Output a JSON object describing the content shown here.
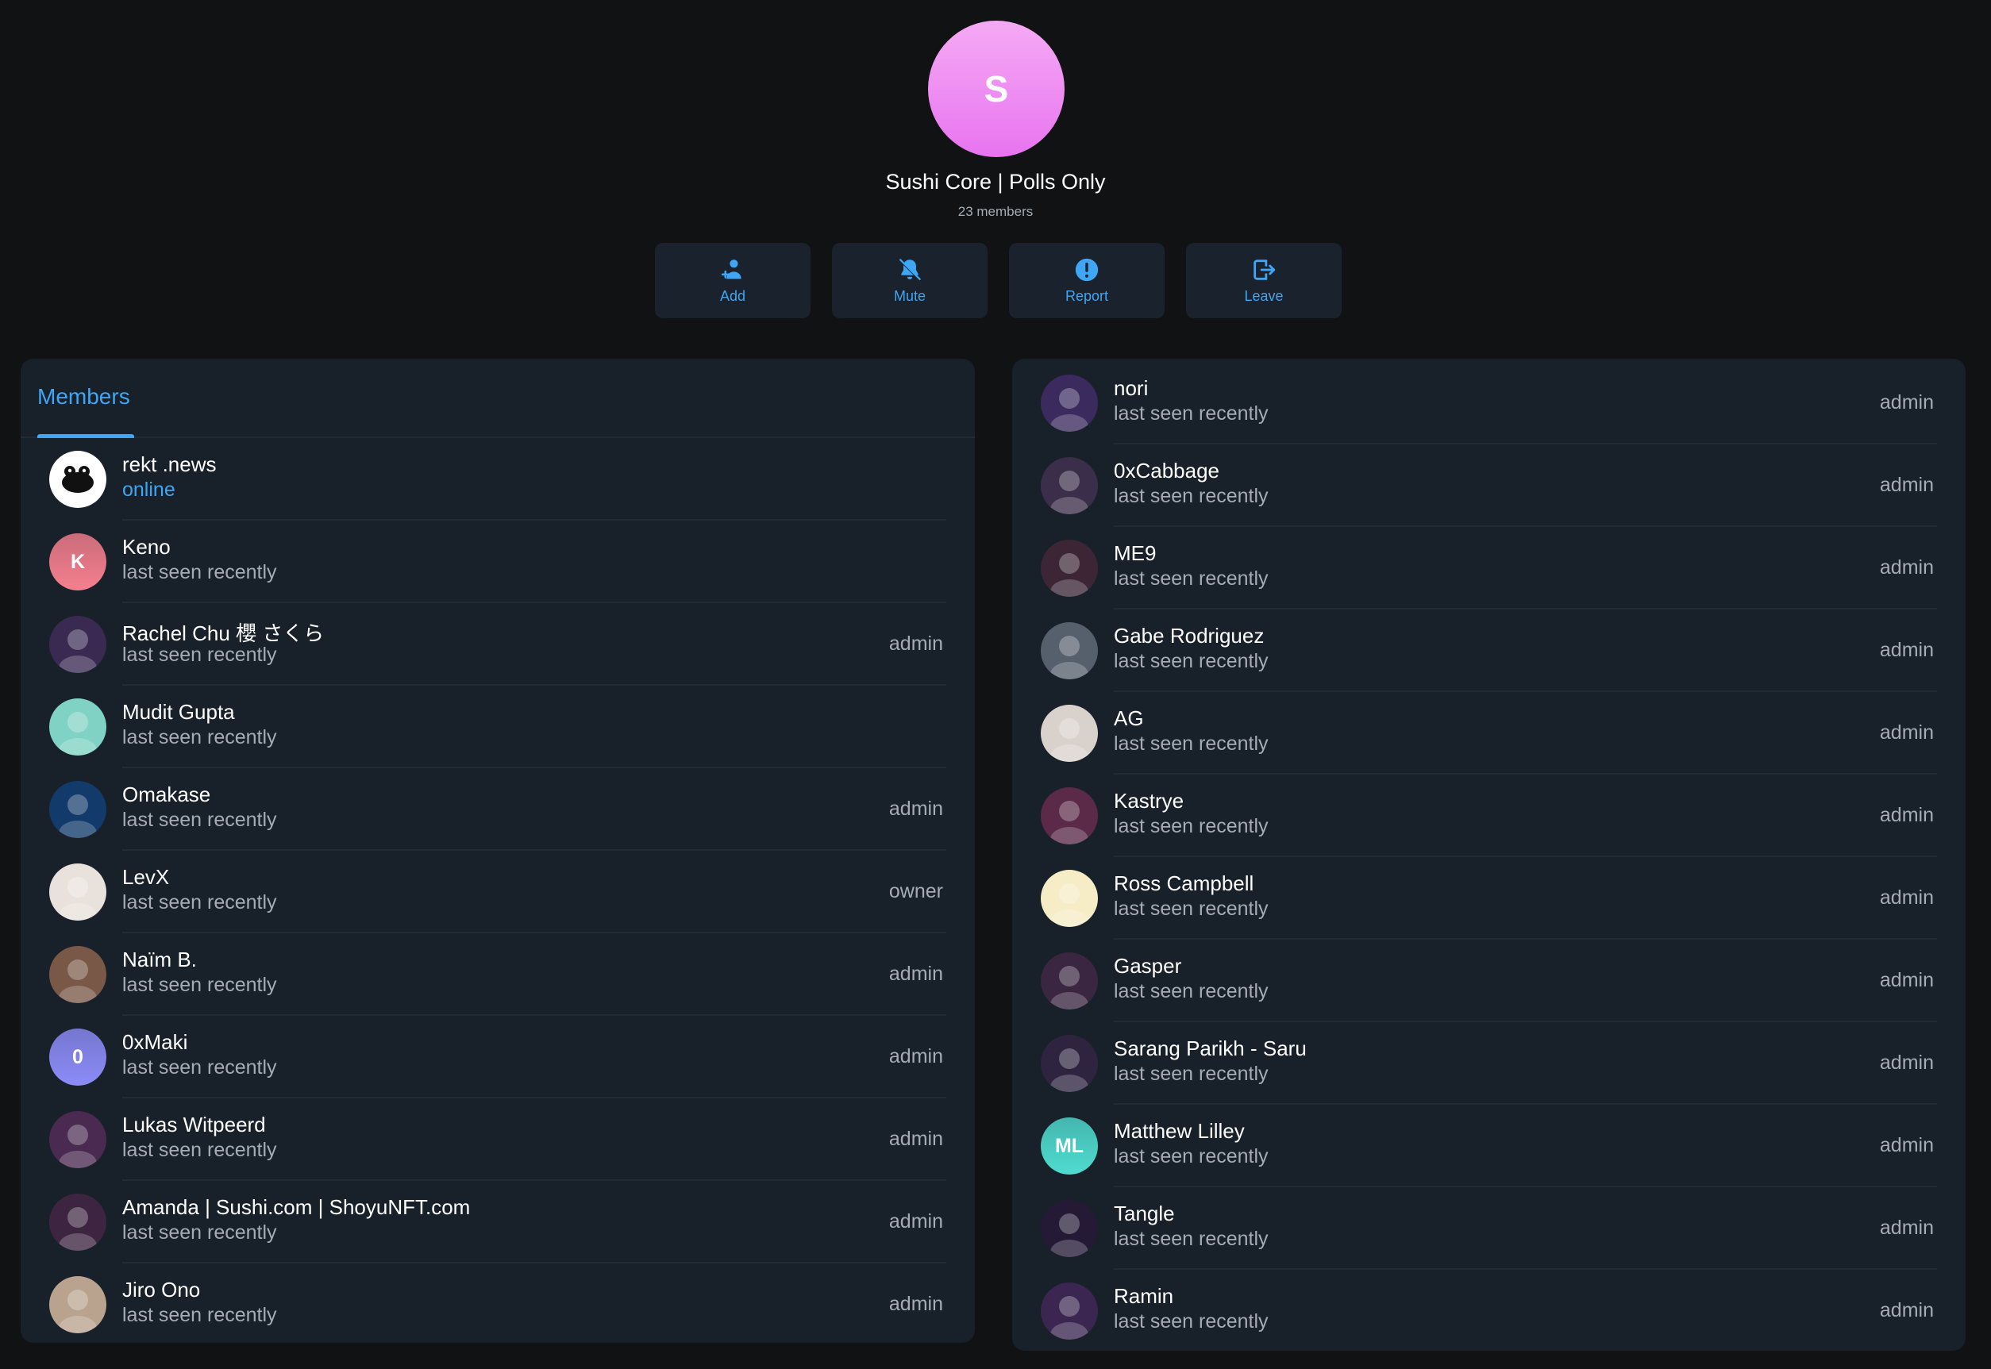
{
  "group": {
    "avatar_letter": "S",
    "avatar_color": "#ee88f3",
    "title": "Sushi Core | Polls Only",
    "members_count": "23 members"
  },
  "actions": [
    {
      "label": "Add",
      "icon": "add-user-icon"
    },
    {
      "label": "Mute",
      "icon": "bell-off-icon"
    },
    {
      "label": "Report",
      "icon": "alert-circle-icon"
    },
    {
      "label": "Leave",
      "icon": "leave-icon"
    }
  ],
  "accent_color": "#3ea6f5",
  "members_tab": {
    "label": "Members"
  },
  "left_members": [
    {
      "name": "rekt .news",
      "status": "online",
      "role": "",
      "avatar": "frog-logo",
      "bg": "#ffffff",
      "initials": ""
    },
    {
      "name": "Keno",
      "status": "last seen recently",
      "role": "",
      "avatar": "initial",
      "bg": "#f67f8e",
      "initials": "K"
    },
    {
      "name": "Rachel Chu 櫻 さくら",
      "status": "last seen recently",
      "role": "admin",
      "avatar": "photo",
      "bg": "#3a2a52",
      "initials": ""
    },
    {
      "name": "Mudit Gupta",
      "status": "last seen recently",
      "role": "",
      "avatar": "penguin",
      "bg": "#7fd2c4",
      "initials": ""
    },
    {
      "name": "Omakase",
      "status": "last seen recently",
      "role": "admin",
      "avatar": "sushi",
      "bg": "#123a6a",
      "initials": ""
    },
    {
      "name": "LevX",
      "status": "last seen recently",
      "role": "owner",
      "avatar": "photo",
      "bg": "#e9e2dc",
      "initials": ""
    },
    {
      "name": "Naïm B.",
      "status": "last seen recently",
      "role": "admin",
      "avatar": "photo",
      "bg": "#7a5848",
      "initials": ""
    },
    {
      "name": "0xMaki",
      "status": "last seen recently",
      "role": "admin",
      "avatar": "initial",
      "bg": "#8c8cf8",
      "initials": "0"
    },
    {
      "name": "Lukas Witpeerd",
      "status": "last seen recently",
      "role": "admin",
      "avatar": "photo",
      "bg": "#4a2a50",
      "initials": ""
    },
    {
      "name": "Amanda | Sushi.com | ShoyuNFT.com",
      "status": "last seen recently",
      "role": "admin",
      "avatar": "photo",
      "bg": "#3d2440",
      "initials": ""
    },
    {
      "name": "Jiro Ono",
      "status": "last seen recently",
      "role": "admin",
      "avatar": "photo",
      "bg": "#b9a38e",
      "initials": ""
    }
  ],
  "right_members": [
    {
      "name": "nori",
      "status": "last seen recently",
      "role": "admin",
      "avatar": "photo",
      "bg": "#3a2a5e",
      "initials": ""
    },
    {
      "name": "0xCabbage",
      "status": "last seen recently",
      "role": "admin",
      "avatar": "photo",
      "bg": "#3b2e4a",
      "initials": ""
    },
    {
      "name": "ME9",
      "status": "last seen recently",
      "role": "admin",
      "avatar": "photo",
      "bg": "#3c2636",
      "initials": ""
    },
    {
      "name": "Gabe Rodriguez",
      "status": "last seen recently",
      "role": "admin",
      "avatar": "photo",
      "bg": "#56606c",
      "initials": ""
    },
    {
      "name": "AG",
      "status": "last seen recently",
      "role": "admin",
      "avatar": "photo",
      "bg": "#d9d2cc",
      "initials": ""
    },
    {
      "name": "Kastrye",
      "status": "last seen recently",
      "role": "admin",
      "avatar": "photo",
      "bg": "#5a2a48",
      "initials": ""
    },
    {
      "name": "Ross Campbell",
      "status": "last seen recently",
      "role": "admin",
      "avatar": "illustration",
      "bg": "#f6ecc6",
      "initials": ""
    },
    {
      "name": "Gasper",
      "status": "last seen recently",
      "role": "admin",
      "avatar": "photo",
      "bg": "#3a2640",
      "initials": ""
    },
    {
      "name": "Sarang Parikh - Saru",
      "status": "last seen recently",
      "role": "admin",
      "avatar": "photo",
      "bg": "#2e2440",
      "initials": ""
    },
    {
      "name": "Matthew Lilley",
      "status": "last seen recently",
      "role": "admin",
      "avatar": "initial",
      "bg": "#4fdcd0",
      "initials": "ML"
    },
    {
      "name": "Tangle",
      "status": "last seen recently",
      "role": "admin",
      "avatar": "photo",
      "bg": "#241a36",
      "initials": ""
    },
    {
      "name": "Ramin",
      "status": "last seen recently",
      "role": "admin",
      "avatar": "photo",
      "bg": "#3a2650",
      "initials": ""
    }
  ]
}
